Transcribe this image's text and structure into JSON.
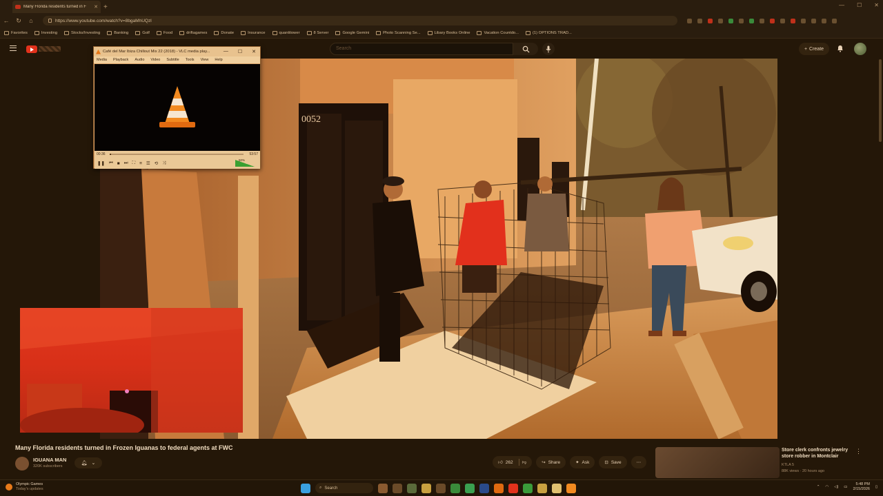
{
  "browser": {
    "tab_title": "Many Florida residents turned in F",
    "url": "https://www.youtube.com/watch?v=8bgaMhUQzl"
  },
  "bookmarks": [
    "Favorites",
    "Investing",
    "Stocks/Investing",
    "Banking",
    "Golf",
    "Food",
    "driftagames",
    "Donate",
    "Insurance",
    "quantitower",
    "8 Server",
    "Google Gemini",
    "Photo Scanning Se...",
    "Libary Books Online",
    "Vacation Countdo...",
    "(1) OPTIONS TRAD..."
  ],
  "youtube": {
    "search_placeholder": "Search",
    "create_label": "Create",
    "video_title": "Many Florida residents turned in Frozen Iguanas to federal agents at FWC",
    "channel_name": "IGUANA MAN",
    "subscribers": "320K subscribers",
    "likes": "262",
    "share_label": "Share",
    "ask_label": "Ask",
    "save_label": "Save",
    "recommended": {
      "title": "Store clerk confronts jewelry store robber in Montclair",
      "channel": "KTLA 5",
      "meta": "88K views · 20 hours ago"
    }
  },
  "vlc": {
    "title": "Café del Mar Ibiza Chillout Mix 22 (2018) - VLC media play...",
    "menu": [
      "Media",
      "Playback",
      "Audio",
      "Video",
      "Subtitle",
      "Tools",
      "View",
      "Help"
    ],
    "elapsed": "00:36",
    "duration": "53:57",
    "volume_label": "50%",
    "progress_fraction": 0.011
  },
  "taskbar": {
    "weather_title": "Olympic Games",
    "weather_sub": "Today's updates",
    "search_label": "Search",
    "time": "5:48 PM",
    "date": "2/15/2026"
  },
  "colors": {
    "accent": "#e2321c",
    "vlc_orange": "#f28a20"
  }
}
